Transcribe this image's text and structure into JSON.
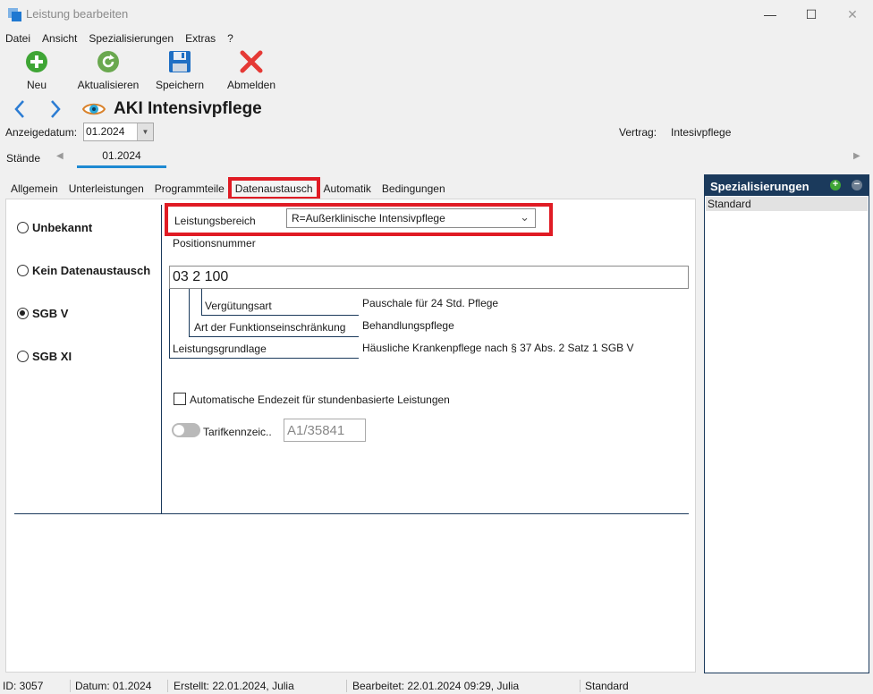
{
  "window": {
    "title": "Leistung bearbeiten",
    "minimize": "—",
    "maximize": "☐",
    "close": "✕"
  },
  "menu": [
    "Datei",
    "Ansicht",
    "Spezialisierungen",
    "Extras",
    "?"
  ],
  "toolbar": {
    "new": "Neu",
    "refresh": "Aktualisieren",
    "save": "Speichern",
    "logout": "Abmelden"
  },
  "header": {
    "title": "AKI Intensivpflege",
    "anzeigedatum_label": "Anzeigedatum:",
    "anzeigedatum_value": "01.2024",
    "vertrag_label": "Vertrag:",
    "vertrag_value": "Intesivpflege",
    "staende_label": "Stände",
    "staende_tab": "01.2024"
  },
  "tabs": [
    "Allgemein",
    "Unterleistungen",
    "Programmteile",
    "Datenaustausch",
    "Automatik",
    "Bedingungen"
  ],
  "active_tab": "Datenaustausch",
  "radios": [
    {
      "label": "Unbekannt",
      "checked": false
    },
    {
      "label": "Kein Datenaustausch",
      "checked": false
    },
    {
      "label": "SGB V",
      "checked": true
    },
    {
      "label": "SGB XI",
      "checked": false
    }
  ],
  "form": {
    "leistungsbereich_label": "Leistungsbereich",
    "leistungsbereich_value": "R=Außerklinische Intensivpflege",
    "positionsnummer_label": "Positionsnummer",
    "positionsnummer_value": "03 2 100",
    "verguetungsart_label": "Vergütungsart",
    "verguetungsart_value": "Pauschale für 24 Std. Pflege",
    "funktion_label": "Art der Funktionseinschränkung",
    "funktion_value": "Behandlungspflege",
    "grundlage_label": "Leistungsgrundlage",
    "grundlage_value": "Häusliche Krankenpflege nach § 37 Abs. 2 Satz 1 SGB V",
    "auto_endzeit_label": "Automatische Endezeit für stundenbasierte Leistungen",
    "auto_endzeit_checked": false,
    "tarif_label": "Tarifkennzeic..",
    "tarif_value": "A1/35841",
    "tarif_enabled": false
  },
  "side_panel": {
    "title": "Spezialisierungen",
    "add": "+",
    "remove": "−",
    "items": [
      "Standard"
    ]
  },
  "status": {
    "id": "ID: 3057",
    "datum": "Datum: 01.2024",
    "erstellt": "Erstellt: 22.01.2024, Julia",
    "bearbeitet": "Bearbeitet: 22.01.2024 09:29, Julia",
    "profil": "Standard"
  },
  "colors": {
    "accent": "#1f8ad2",
    "highlight": "#e01b24",
    "panel_dark": "#1b3a5c",
    "ok_green": "#3fa535"
  }
}
